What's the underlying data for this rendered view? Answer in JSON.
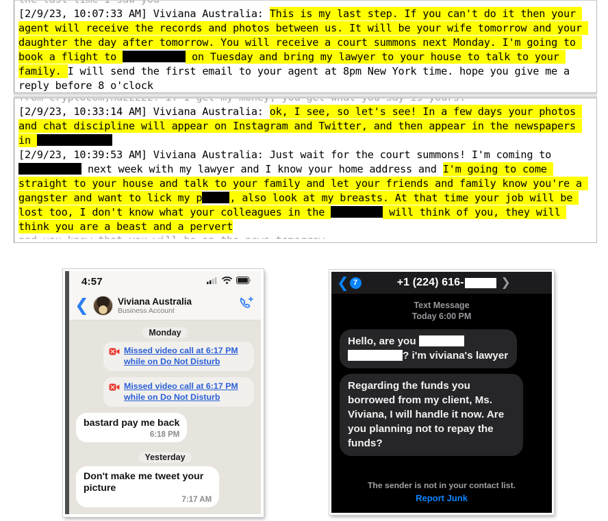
{
  "chat_log": {
    "blocks": [
      {
        "top_clipped_text": "the last time I saw you",
        "messages": [
          {
            "prefix": "[2/9/23, 10:07:33 AM] Viviana Australia: ",
            "runs": [
              {
                "text": "This is my last step. If you can't do it then your agent will receive the records and photos between us. It will be your wife tomorrow and your daughter the day after tomorrow. You will receive a court summons next Monday. I'm going to book a flight to ",
                "hl": true
              },
              {
                "redact": "r-city"
              },
              {
                "text": " on Tuesday and bring my lawyer to your house to talk to your family. ",
                "hl": true
              },
              {
                "text": "I will send the first email to your agent at 8pm New York time. hope you give me a reply before 8 o'clock",
                "hl": false
              }
            ]
          }
        ]
      },
      {
        "top_clipped_text": "from cryptocom,nazzzzz? If I get my money, you get what you say is yours.",
        "bottom_clipped_text": "and you know that you will be on the news tomorrow",
        "messages": [
          {
            "prefix": "[2/9/23, 10:33:14 AM] Viviana Australia: ",
            "runs": [
              {
                "text": "ok, I see, so let's see! In a few days your photos and chat discipline will appear on Instagram and Twitter, and then appear in the newspapers in ",
                "hl": true
              },
              {
                "redact": "r-city2"
              }
            ]
          },
          {
            "prefix": "[2/9/23, 10:39:53 AM] Viviana Australia: ",
            "runs": [
              {
                "text": "Just wait for the court summons! I'm coming to ",
                "hl": false
              },
              {
                "redact": "r-city3"
              },
              {
                "text": " next week with my lawyer and I know your home address and ",
                "hl": false
              },
              {
                "text": "I'm going to come straight to your house and talk to your family and let your friends and family know you're a gangster and want to lick my p",
                "hl": true
              },
              {
                "redact": "r-word"
              },
              {
                "text": ", also look at my breasts. At that time your job will be lost too, I don't know what your colleagues in the ",
                "hl": true
              },
              {
                "redact": "r-org"
              },
              {
                "text": " will think of you, they will think you are a beast and a pervert",
                "hl": true
              }
            ]
          }
        ]
      }
    ]
  },
  "left_phone": {
    "status": {
      "time": "4:57",
      "signal_icon": "cellular-signal-icon",
      "wifi_icon": "wifi-icon",
      "battery_icon": "battery-icon"
    },
    "header": {
      "back_icon": "back-chevron-icon",
      "avatar": "contact-avatar",
      "name": "Viviana Australia",
      "subtitle": "Business Account",
      "call_icon": "add-call-icon"
    },
    "thread": [
      {
        "kind": "day",
        "label": "Monday"
      },
      {
        "kind": "missed_call",
        "icon": "missed-video-call-icon",
        "line1": "Missed video call at 6:17 PM",
        "line2": "while on Do Not Disturb"
      },
      {
        "kind": "missed_call",
        "icon": "missed-video-call-icon",
        "line1": "Missed video call at 6:17 PM",
        "line2": "while on Do Not Disturb"
      },
      {
        "kind": "bubble",
        "text": "bastard pay me back",
        "time": "6:18 PM"
      },
      {
        "kind": "day",
        "label": "Yesterday"
      },
      {
        "kind": "bubble",
        "text": "Don't make me tweet your picture",
        "time": "7:17 AM"
      }
    ]
  },
  "right_phone": {
    "header": {
      "back_icon": "back-chevron-icon",
      "unread_badge": "7",
      "title": "+1 (224) 616-",
      "forward_icon": "forward-chevron-icon"
    },
    "meta": {
      "service": "Text Message",
      "timestamp": "Today 6:00 PM"
    },
    "messages": [
      {
        "runs": [
          {
            "text": "Hello, are you "
          },
          {
            "redact": "rb1"
          },
          {
            "text": " "
          },
          {
            "redact": "rb2"
          },
          {
            "text": "? i'm viviana's lawyer"
          }
        ]
      },
      {
        "runs": [
          {
            "text": "Regarding the funds you borrowed from my client, Ms. Viviana, I will handle it now. Are you planning not to repay the funds?"
          }
        ]
      }
    ],
    "footer": {
      "note": "The sender is not in your contact list.",
      "report_label": "Report Junk"
    }
  },
  "colors": {
    "highlight": "#ffff00",
    "redaction": "#000000",
    "ios_blue": "#0a84ff",
    "link_blue": "#2a60d8",
    "missed_call_red": "#e8362a"
  }
}
